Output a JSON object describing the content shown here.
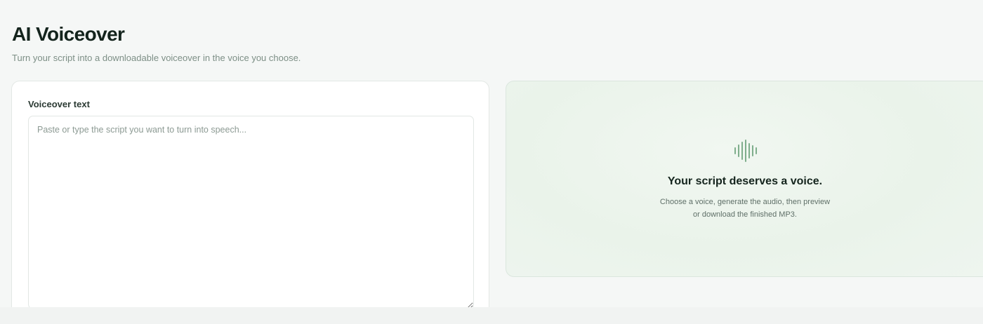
{
  "header": {
    "title": "AI Voiceover",
    "subtitle": "Turn your script into a downloadable voiceover in the voice you choose."
  },
  "editor": {
    "label": "Voiceover text",
    "placeholder": "Paste or type the script you want to turn into speech...",
    "value": ""
  },
  "preview": {
    "icon": "sound-wave-icon",
    "heading": "Your script deserves a voice.",
    "description_line1": "Choose a voice, generate the audio, then preview",
    "description_line2": "or download the finished MP3."
  },
  "colors": {
    "accent": "#7fae8c",
    "title": "#14241d",
    "muted": "#7d8f86",
    "panel_bg": "#eaf3ea"
  }
}
